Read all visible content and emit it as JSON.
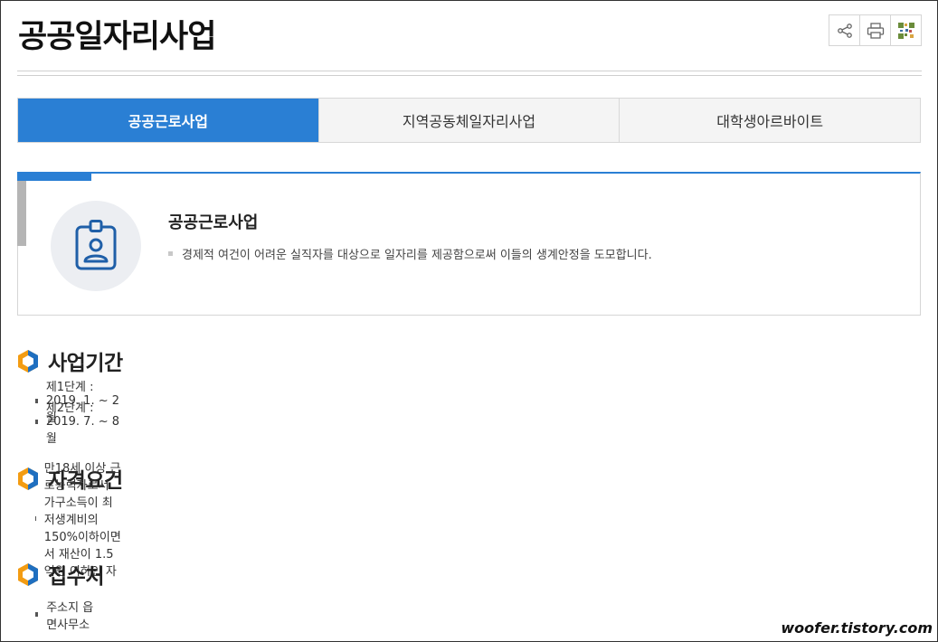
{
  "page": {
    "title": "공공일자리사업"
  },
  "toolbar": {
    "share_icon": "share-icon",
    "print_icon": "print-icon",
    "qr_icon": "qr-code-icon"
  },
  "tabs": [
    {
      "label": "공공근로사업",
      "active": true
    },
    {
      "label": "지역공동체일자리사업",
      "active": false
    },
    {
      "label": "대학생아르바이트",
      "active": false
    }
  ],
  "info": {
    "icon": "id-badge-icon",
    "title": "공공근로사업",
    "description": "경제적 여건이 어려운 실직자를 대상으로 일자리를 제공함으로써 이들의 생계안정을 도모합니다."
  },
  "sections": [
    {
      "heading": "사업기간",
      "items": [
        "제1단계 : 2019. 1. ~ 2월",
        "제2단계 : 2019. 7. ~ 8월"
      ]
    },
    {
      "heading": "자격요건",
      "items": [
        "만18세 이상 근로능력자로서 가구소득이 최저생계비의 150%이하이면서 재산이 1.5억원 이하인 자"
      ]
    },
    {
      "heading": "접수처",
      "items": [
        "주소지 읍면사무소"
      ]
    }
  ],
  "watermark": "woofer.tistory.com",
  "colors": {
    "accent": "#2a7fd4",
    "hex_orange": "#f39c12",
    "hex_blue": "#1f6fc0"
  }
}
